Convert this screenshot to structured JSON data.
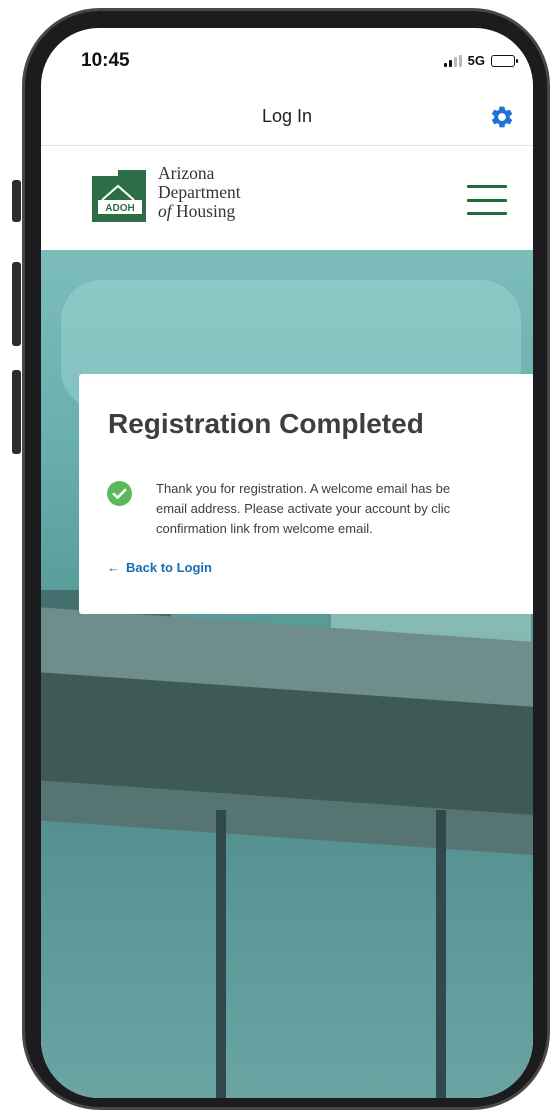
{
  "status_bar": {
    "time": "10:45",
    "network": "5G"
  },
  "browser": {
    "title": "Log In",
    "settings_icon": "gear-icon"
  },
  "site_header": {
    "logo_badge": "ADOH",
    "logo_line1": "Arizona",
    "logo_line2": "Department",
    "logo_line3_italic": "of",
    "logo_line3_rest": " Housing",
    "menu_icon": "hamburger-menu-icon"
  },
  "card": {
    "title": "Registration Completed",
    "message_lines": [
      "Thank you for registration. A welcome email has be",
      "email address. Please activate your account by clic",
      "confirmation link from welcome email."
    ],
    "back_link": "Back to Login",
    "back_arrow": "←"
  },
  "colors": {
    "brand_green": "#1f6e3e",
    "link_blue": "#1a6cb5",
    "success_green": "#5cb85c",
    "gear_blue": "#1e73d8"
  }
}
